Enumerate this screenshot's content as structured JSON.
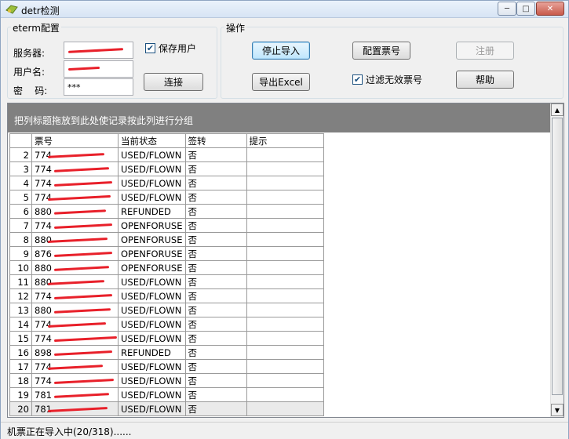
{
  "window": {
    "title": "detr检测"
  },
  "eterm": {
    "legend": "eterm配置",
    "server_label": "服务器:",
    "server_value": "",
    "user_label": "用户名:",
    "user_value": "",
    "password_label": "密    码:",
    "password_value": "***",
    "save_user_label": "保存用户",
    "save_user_checked": true,
    "connect_label": "连接"
  },
  "ops": {
    "legend": "操作",
    "stop_import_label": "停止导入",
    "export_excel_label": "导出Excel",
    "config_ticket_label": "配置票号",
    "filter_invalid_label": "过滤无效票号",
    "filter_invalid_checked": true,
    "register_label": "注册",
    "help_label": "帮助"
  },
  "grid": {
    "group_hint": "把列标题拖放到此处使记录按此列进行分组",
    "columns": [
      "票号",
      "当前状态",
      "签转",
      "提示"
    ],
    "rows": [
      {
        "n": "2",
        "ticket": "774",
        "status": "USED/FLOWN",
        "endorse": "否",
        "note": ""
      },
      {
        "n": "3",
        "ticket": "774",
        "status": "USED/FLOWN",
        "endorse": "否",
        "note": ""
      },
      {
        "n": "4",
        "ticket": "774",
        "status": "USED/FLOWN",
        "endorse": "否",
        "note": ""
      },
      {
        "n": "5",
        "ticket": "774",
        "status": "USED/FLOWN",
        "endorse": "否",
        "note": ""
      },
      {
        "n": "6",
        "ticket": "880",
        "status": "REFUNDED",
        "endorse": "否",
        "note": ""
      },
      {
        "n": "7",
        "ticket": "774",
        "status": "OPENFORUSE",
        "endorse": "否",
        "note": ""
      },
      {
        "n": "8",
        "ticket": "880",
        "status": "OPENFORUSE",
        "endorse": "否",
        "note": ""
      },
      {
        "n": "9",
        "ticket": "876",
        "status": "OPENFORUSE",
        "endorse": "否",
        "note": ""
      },
      {
        "n": "10",
        "ticket": "880",
        "status": "OPENFORUSE",
        "endorse": "否",
        "note": ""
      },
      {
        "n": "11",
        "ticket": "880",
        "status": "USED/FLOWN",
        "endorse": "否",
        "note": ""
      },
      {
        "n": "12",
        "ticket": "774",
        "status": "USED/FLOWN",
        "endorse": "否",
        "note": ""
      },
      {
        "n": "13",
        "ticket": "880",
        "status": "USED/FLOWN",
        "endorse": "否",
        "note": ""
      },
      {
        "n": "14",
        "ticket": "774",
        "status": "USED/FLOWN",
        "endorse": "否",
        "note": ""
      },
      {
        "n": "15",
        "ticket": "774",
        "status": "USED/FLOWN",
        "endorse": "否",
        "note": ""
      },
      {
        "n": "16",
        "ticket": "898",
        "status": "REFUNDED",
        "endorse": "否",
        "note": ""
      },
      {
        "n": "17",
        "ticket": "774",
        "status": "USED/FLOWN",
        "endorse": "否",
        "note": ""
      },
      {
        "n": "18",
        "ticket": "774",
        "status": "USED/FLOWN",
        "endorse": "否",
        "note": ""
      },
      {
        "n": "19",
        "ticket": "781",
        "status": "USED/FLOWN",
        "endorse": "否",
        "note": ""
      },
      {
        "n": "20",
        "ticket": "781",
        "status": "USED/FLOWN",
        "endorse": "否",
        "note": ""
      }
    ]
  },
  "status": {
    "text": "机票正在导入中(20/318)......"
  },
  "colors": {
    "redaction": "#e8202a",
    "group_panel": "#808080"
  }
}
